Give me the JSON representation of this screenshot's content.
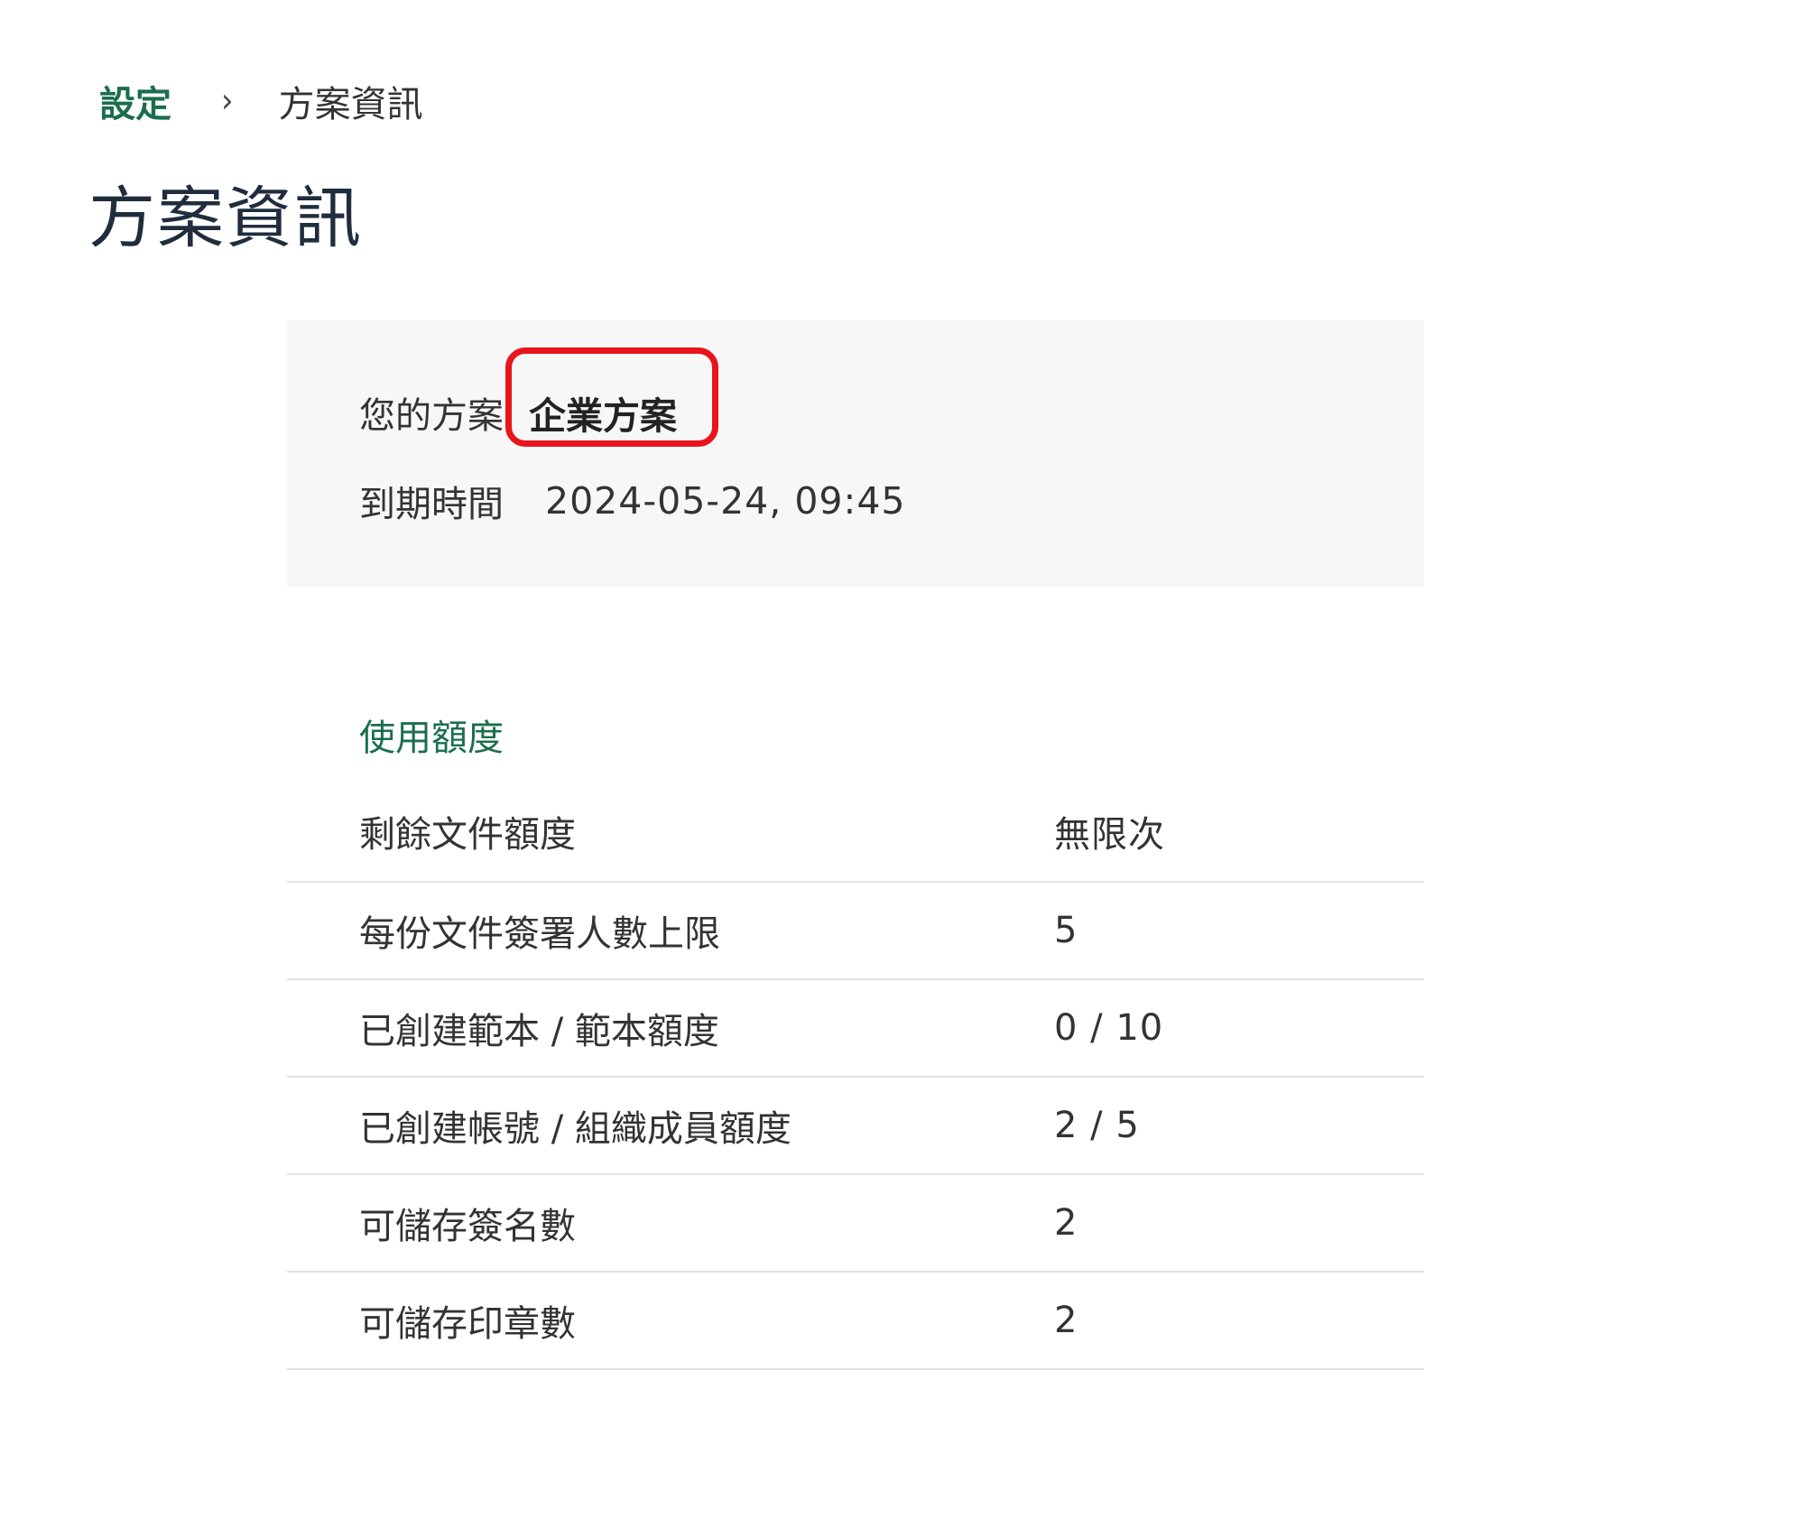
{
  "breadcrumb": {
    "parent": "設定",
    "separator": "›",
    "current": "方案資訊"
  },
  "page_title": "方案資訊",
  "plan": {
    "plan_label": "您的方案",
    "plan_name": "企業方案",
    "expiry_label": "到期時間",
    "expiry_value": "2024-05-24, 09:45"
  },
  "usage": {
    "title": "使用額度",
    "rows": [
      {
        "label": "剩餘文件額度",
        "value": "無限次"
      },
      {
        "label": "每份文件簽署人數上限",
        "value": "5"
      },
      {
        "label": "已創建範本 / 範本額度",
        "value": "0 / 10"
      },
      {
        "label": "已創建帳號 / 組織成員額度",
        "value": "2 / 5"
      },
      {
        "label": "可儲存簽名數",
        "value": "2"
      },
      {
        "label": "可儲存印章數",
        "value": "2"
      }
    ]
  },
  "colors": {
    "accent_green": "#1b6e4c",
    "highlight_red": "#e8141c",
    "card_background": "#f7f7f7"
  }
}
